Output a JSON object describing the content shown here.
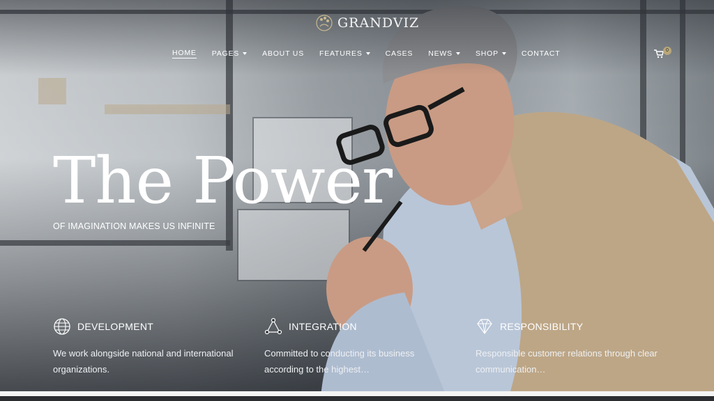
{
  "brand": {
    "name": "GRANDVIZ",
    "logo_icon": "laurel-mark-icon"
  },
  "nav": {
    "items": [
      {
        "label": "HOME",
        "active": true,
        "dropdown": false
      },
      {
        "label": "PAGES",
        "active": false,
        "dropdown": true
      },
      {
        "label": "ABOUT US",
        "active": false,
        "dropdown": false
      },
      {
        "label": "FEATURES",
        "active": false,
        "dropdown": true
      },
      {
        "label": "CASES",
        "active": false,
        "dropdown": false
      },
      {
        "label": "NEWS",
        "active": false,
        "dropdown": true
      },
      {
        "label": "SHOP",
        "active": false,
        "dropdown": true
      },
      {
        "label": "CONTACT",
        "active": false,
        "dropdown": false
      }
    ]
  },
  "cart": {
    "icon": "cart-icon",
    "count": "0"
  },
  "hero": {
    "title": "The Power",
    "subtitle": "OF IMAGINATION MAKES US INFINITE"
  },
  "features": [
    {
      "icon": "globe-icon",
      "title": "DEVELOPMENT",
      "text": "We work alongside national and international organizations."
    },
    {
      "icon": "network-triangle-icon",
      "title": "INTEGRATION",
      "text": "Committed to conducting its business according to the highest…"
    },
    {
      "icon": "diamond-icon",
      "title": "RESPONSIBILITY",
      "text": "Responsible customer relations through clear communication…"
    }
  ],
  "colors": {
    "accent": "#b9a77a",
    "text": "#ffffff"
  }
}
